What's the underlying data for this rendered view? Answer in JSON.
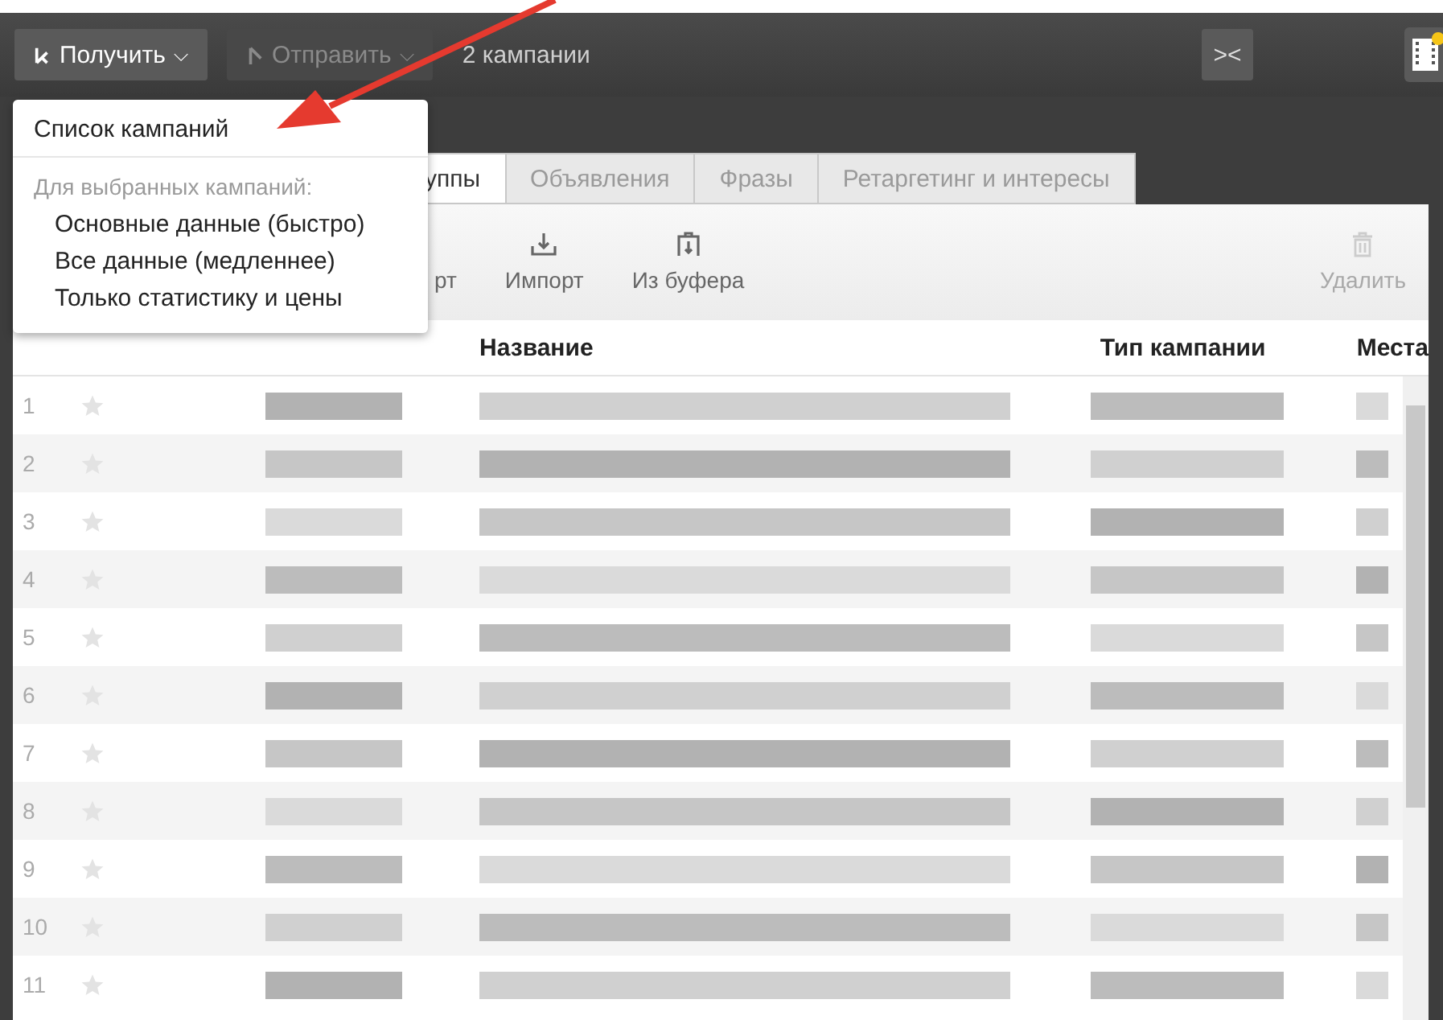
{
  "toolbar": {
    "get_button": {
      "label": "Получить",
      "caret": "⌵"
    },
    "send_button": {
      "label": "Отправить",
      "caret": "⌵",
      "disabled": true
    },
    "selection_count": "2 кампании",
    "collapse_button": "><"
  },
  "dropdown": {
    "items": [
      {
        "kind": "item",
        "label": "Список кампаний"
      },
      {
        "kind": "header",
        "label": "Для выбранных кампаний:"
      },
      {
        "kind": "subitem",
        "label": "Основные данные (быстро)"
      },
      {
        "kind": "subitem",
        "label": "Все данные (медленнее)"
      },
      {
        "kind": "subitem",
        "label": "Только статистику и цены"
      }
    ]
  },
  "tabs": [
    {
      "label": "уппы",
      "selected": true
    },
    {
      "label": "Объявления",
      "selected": false
    },
    {
      "label": "Фразы",
      "selected": false
    },
    {
      "label": "Ретаргетинг и интересы",
      "selected": false
    }
  ],
  "actions": [
    {
      "kind": "export",
      "label": "рт",
      "disabled": false
    },
    {
      "kind": "import",
      "label": "Импорт",
      "disabled": false
    },
    {
      "kind": "clipboard",
      "label": "Из буфера",
      "disabled": false
    },
    {
      "kind": "delete",
      "label": "Удалить",
      "disabled": true
    }
  ],
  "table": {
    "columns": [
      {
        "label": "Название"
      },
      {
        "label": "Тип кампании"
      },
      {
        "label": "Места"
      }
    ],
    "rows": [
      {
        "number": "1",
        "starred": false
      },
      {
        "number": "2",
        "starred": false
      },
      {
        "number": "3",
        "starred": false
      },
      {
        "number": "4",
        "starred": false
      },
      {
        "number": "5",
        "starred": false
      },
      {
        "number": "6",
        "starred": false
      },
      {
        "number": "7",
        "starred": false
      },
      {
        "number": "8",
        "starred": false
      },
      {
        "number": "9",
        "starred": false
      },
      {
        "number": "10",
        "starred": false
      },
      {
        "number": "11",
        "starred": false
      }
    ]
  }
}
